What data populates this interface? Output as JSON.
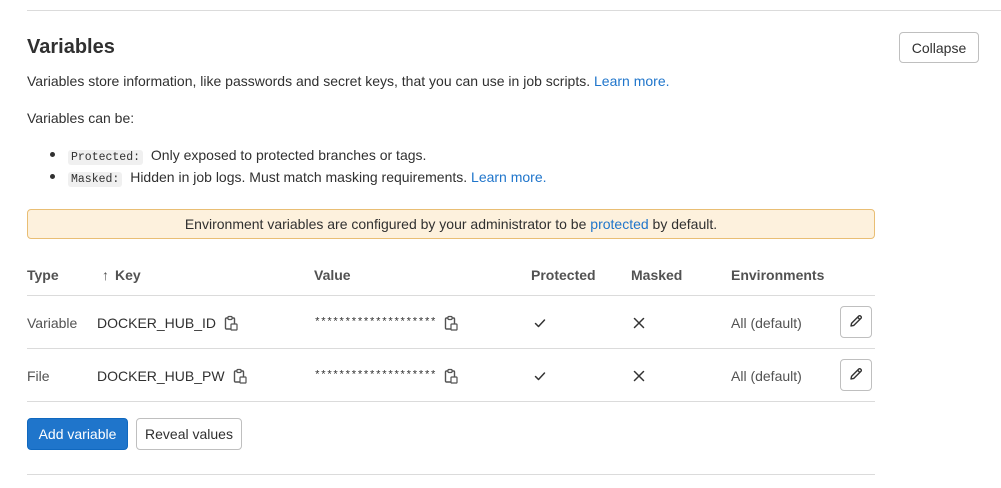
{
  "section": {
    "title": "Variables",
    "collapse_label": "Collapse",
    "description": "Variables store information, like passwords and secret keys, that you can use in job scripts.",
    "learn_more": "Learn more.",
    "can_be": "Variables can be:",
    "bullets": [
      {
        "code": "Protected:",
        "text": "Only exposed to protected branches or tags.",
        "link": ""
      },
      {
        "code": "Masked:",
        "text": "Hidden in job logs. Must match masking requirements.",
        "link": "Learn more."
      }
    ]
  },
  "alert": {
    "before": "Environment variables are configured by your administrator to be",
    "link": "protected",
    "after": "by default."
  },
  "table": {
    "headers": {
      "type": "Type",
      "key": "Key",
      "value": "Value",
      "protected": "Protected",
      "masked": "Masked",
      "environments": "Environments"
    },
    "sort_icon": "arrow-up-icon",
    "rows": [
      {
        "type": "Variable",
        "key": "DOCKER_HUB_ID",
        "value": "********************",
        "protected": true,
        "masked": false,
        "environment": "All (default)"
      },
      {
        "type": "File",
        "key": "DOCKER_HUB_PW",
        "value": "********************",
        "protected": true,
        "masked": false,
        "environment": "All (default)"
      }
    ]
  },
  "actions": {
    "add_label": "Add variable",
    "reveal_label": "Reveal values"
  },
  "colors": {
    "primary": "#1f75cb",
    "alert_bg": "#fdf1dd",
    "alert_border": "#e9be74"
  }
}
